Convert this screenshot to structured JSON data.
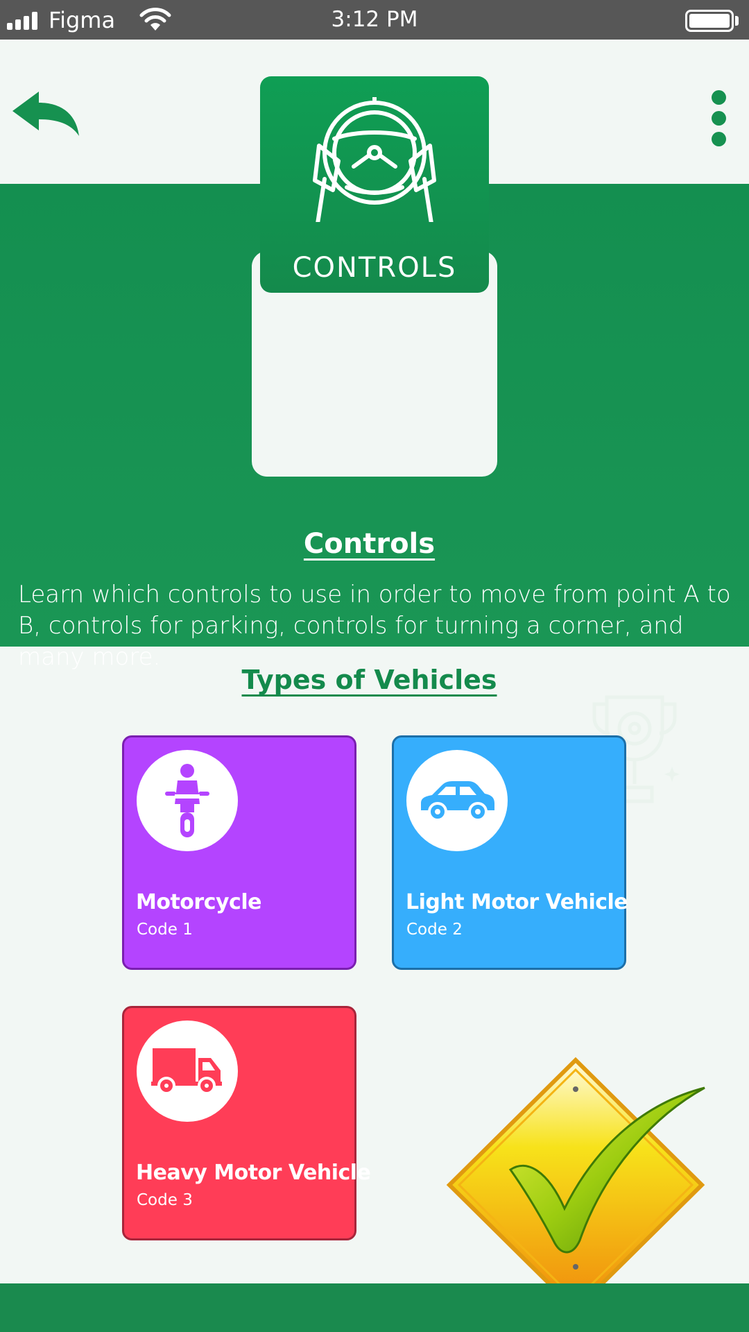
{
  "status_bar": {
    "carrier": "Figma",
    "time": "3:12 PM"
  },
  "header": {
    "back_icon": "back-arrow-icon",
    "menu_icon": "more-vertical-icon"
  },
  "hero": {
    "badge_icon": "steering-wheel-icon",
    "badge_label": "CONTROLS",
    "title": "Controls",
    "description": "Learn which controls to use in order to move from point A to B, controls for parking, controls for turning a corner, and many more.",
    "decoration_icon": "trophy-icon"
  },
  "vehicles": {
    "section_title": "Types of Vehicles",
    "items": [
      {
        "name": "Motorcycle",
        "code": "Code 1",
        "icon": "motorcycle-icon",
        "color": "#b444ff"
      },
      {
        "name": "Light Motor Vehicle",
        "code": "Code 2",
        "icon": "car-icon",
        "color": "#36aefc"
      },
      {
        "name": "Heavy Motor Vehicle",
        "code": "Code 3",
        "icon": "truck-icon",
        "color": "#ff3d57"
      }
    ]
  },
  "decoration": {
    "icon": "checkmark-sign-icon"
  },
  "colors": {
    "primary": "#169150",
    "background": "#f2f7f4"
  }
}
